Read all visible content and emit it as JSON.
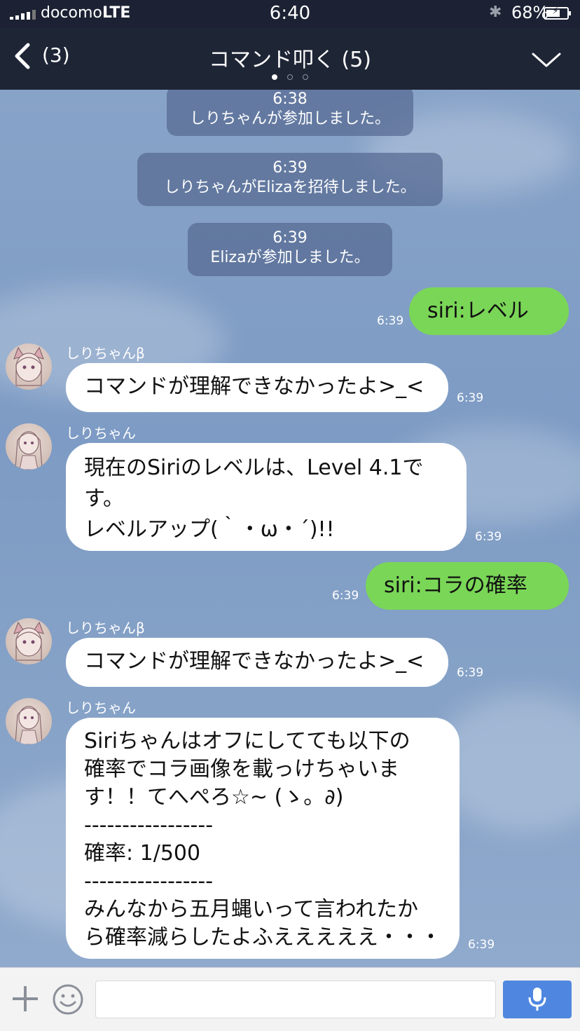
{
  "status": {
    "carrier": "docomo",
    "network": "LTE",
    "time": "6:40",
    "battery": "68%",
    "battery_level": 0.68
  },
  "nav": {
    "back_count": "(3)",
    "title": "コマンド叩く (5)",
    "pages": 3,
    "active_page": 0
  },
  "messages": [
    {
      "type": "system",
      "time": "6:38",
      "text": "しりちゃんが参加しました。"
    },
    {
      "type": "system",
      "time": "6:39",
      "text": "しりちゃんがElizaを招待しました。"
    },
    {
      "type": "system",
      "time": "6:39",
      "text": "Elizaが参加しました。"
    },
    {
      "type": "out",
      "text": "siri:レベル",
      "time": "6:39"
    },
    {
      "type": "in",
      "sender": "しりちゃんβ",
      "text": "コマンドが理解できなかったよ>_<",
      "time": "6:39"
    },
    {
      "type": "in",
      "sender": "しりちゃん",
      "text": "現在のSiriのレベルは、Level 4.1で\nす。\nレベルアップ(｀・ω・´)!!",
      "time": "6:39"
    },
    {
      "type": "out",
      "text": "siri:コラの確率",
      "time": "6:39"
    },
    {
      "type": "in",
      "sender": "しりちゃんβ",
      "text": "コマンドが理解できなかったよ>_<",
      "time": "6:39"
    },
    {
      "type": "in",
      "sender": "しりちゃん",
      "text": "Siriちゃんはオフにしてても以下の\n確率でコラ画像を載っけちゃいま\nす！！てへぺろ☆~ (ゝ。∂)\n-----------------\n確率: 1/500\n-----------------\nみんなから五月蝿いって言われたか\nら確率減らしたよふえええええ・・・",
      "time": "6:39"
    }
  ],
  "colors": {
    "outgoing_bubble": "#7ad657",
    "incoming_bubble": "#ffffff",
    "mic_button": "#4f87e0"
  }
}
